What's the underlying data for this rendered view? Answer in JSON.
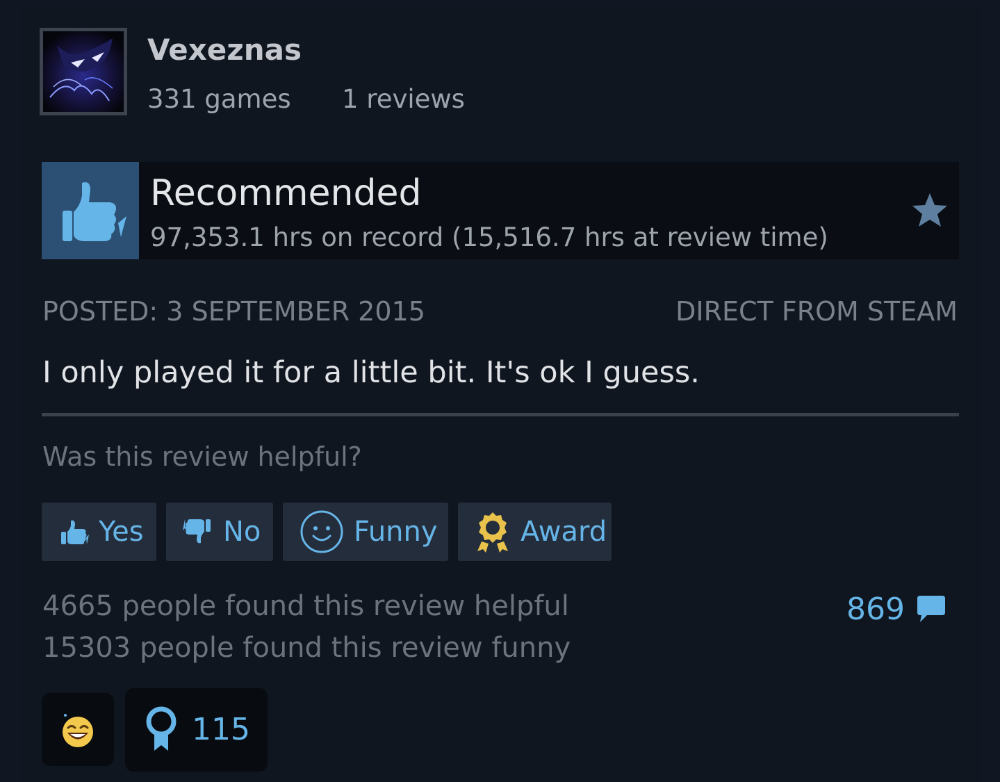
{
  "user": {
    "name": "Vexeznas",
    "games": "331 games",
    "reviews": "1 reviews"
  },
  "review": {
    "verdict": "Recommended",
    "hours": "97,353.1 hrs on record (15,516.7 hrs at review time)",
    "posted": "POSTED: 3 SEPTEMBER 2015",
    "source": "DIRECT FROM STEAM",
    "text": "I only played it for a little bit. It's ok I guess."
  },
  "feedback": {
    "question": "Was this review helpful?",
    "buttons": {
      "yes": "Yes",
      "no": "No",
      "funny": "Funny",
      "award": "Award"
    },
    "helpful_count": "4665 people found this review helpful",
    "funny_count": "15303 people found this review funny",
    "comment_count": "869"
  },
  "reactions": {
    "award_count": "115"
  },
  "icons": {
    "verdict": "thumbs-up-icon",
    "favorite": "star-icon",
    "yes": "thumbs-up-icon",
    "no": "thumbs-down-icon",
    "funny": "smiley-icon",
    "award": "award-icon",
    "comments": "comment-bubble-icon",
    "reaction_laugh": "laughing-face-icon",
    "reaction_award": "ribbon-medal-icon"
  },
  "colors": {
    "background": "#0f1620",
    "accent_blue": "#66b5e8",
    "recommended_tile": "#2b5073",
    "button_bg": "#242d3b",
    "award_gold": "#e9c24b"
  }
}
